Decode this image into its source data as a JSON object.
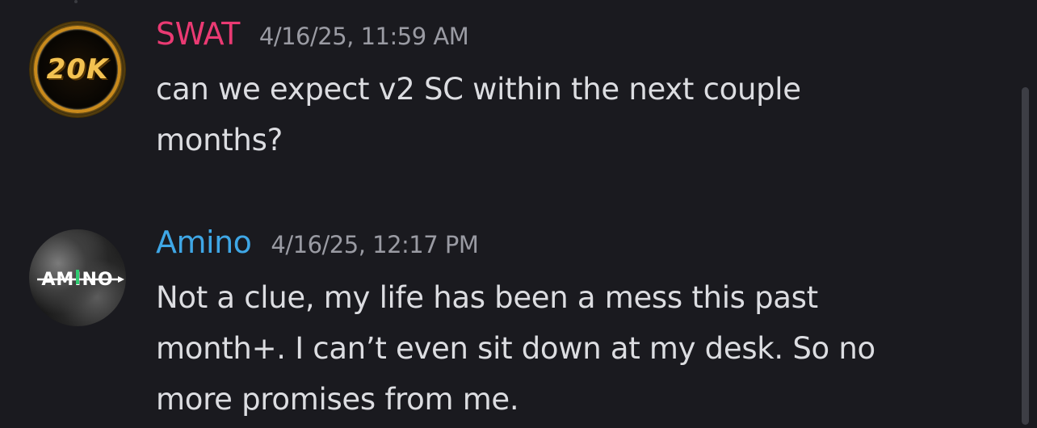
{
  "messages": [
    {
      "username": "SWAT",
      "username_color": "#ea3a73",
      "timestamp": "4/16/25, 11:59 AM",
      "text": "can we expect v2 SC within the next couple\nmonths?",
      "avatar": {
        "name": "20k-logo-avatar",
        "text": "20K"
      }
    },
    {
      "username": "Amino",
      "username_color": "#3fa7e6",
      "timestamp": "4/16/25, 12:17 PM",
      "text": "Not a clue, my life has been a mess this past\nmonth+. I can’t even sit down at my desk. So no\nmore promises from me.",
      "avatar": {
        "name": "amino-logo-avatar",
        "text": "AMINO"
      }
    }
  ]
}
